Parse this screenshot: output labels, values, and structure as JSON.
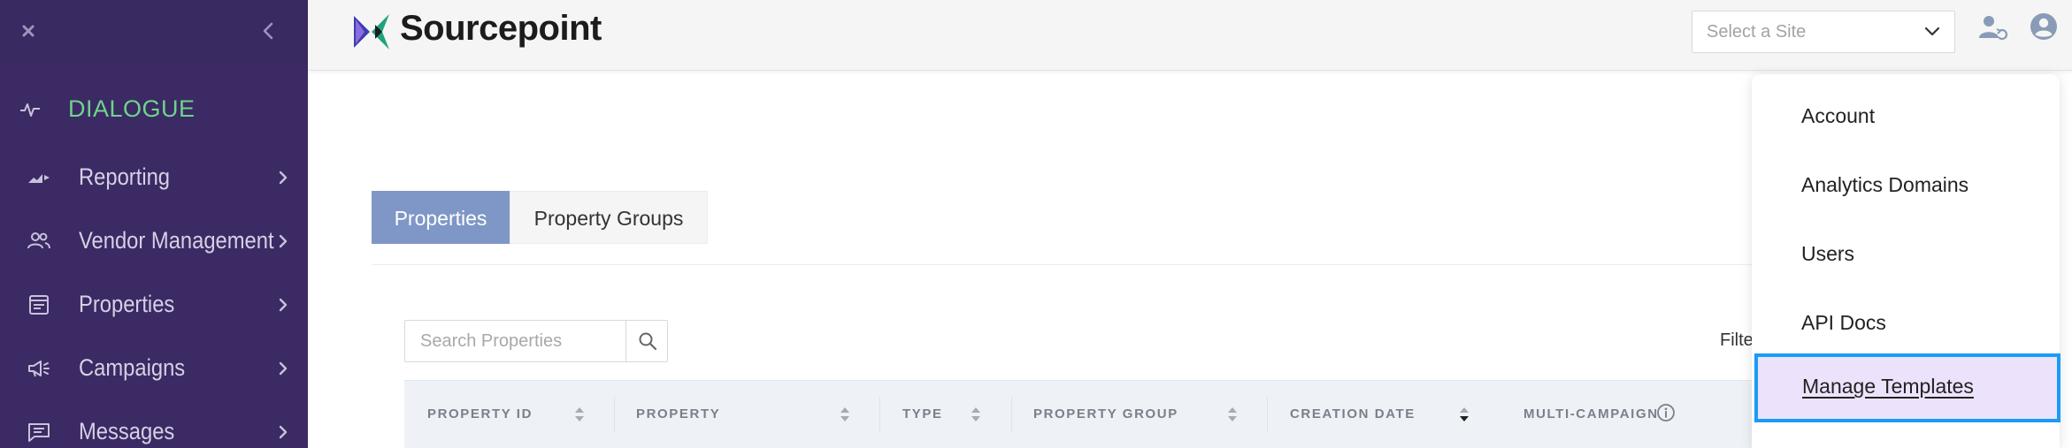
{
  "sidebar": {
    "section_label": "DIALOGUE",
    "items": [
      {
        "label": "Reporting",
        "icon": "reporting-icon"
      },
      {
        "label": "Vendor Management",
        "icon": "vendor-management-icon"
      },
      {
        "label": "Properties",
        "icon": "properties-icon"
      },
      {
        "label": "Campaigns",
        "icon": "campaigns-icon"
      },
      {
        "label": "Messages",
        "icon": "messages-icon"
      }
    ],
    "colors": {
      "background": "#3b2a63",
      "section": "#6fd38c",
      "text": "#d6d0e6"
    }
  },
  "header": {
    "brand_name": "Sourcepoint",
    "site_select_placeholder": "Select a Site"
  },
  "tabs": [
    {
      "label": "Properties",
      "active": true
    },
    {
      "label": "Property Groups",
      "active": false
    }
  ],
  "search": {
    "placeholder": "Search Properties"
  },
  "filter_label": "Filte",
  "table": {
    "columns": [
      "PROPERTY ID",
      "PROPERTY",
      "TYPE",
      "PROPERTY GROUP",
      "CREATION DATE",
      "MULTI-CAMPAIGN"
    ]
  },
  "account_menu": {
    "items": [
      {
        "label": "Account"
      },
      {
        "label": "Analytics Domains"
      },
      {
        "label": "Users"
      },
      {
        "label": "API Docs"
      },
      {
        "label": "Manage Templates",
        "highlighted": true
      }
    ],
    "highlight_color": "#1a9bf5"
  },
  "colors": {
    "accent": "#7f97c6",
    "header_bg": "#f5f5f5"
  }
}
